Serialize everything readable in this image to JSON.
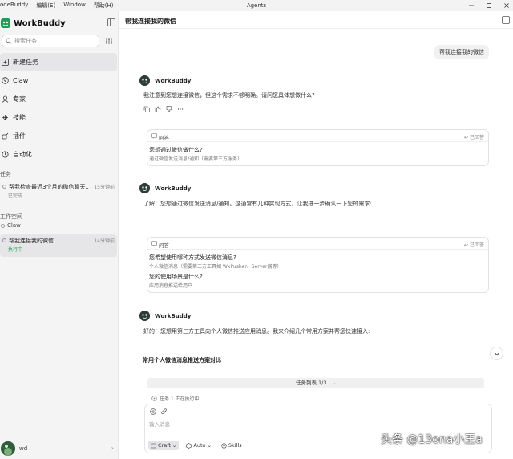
{
  "titlebar": {
    "menu": [
      "odeBuddy",
      "编辑(E)",
      "Window",
      "帮助(H)"
    ],
    "window_title": "Agents"
  },
  "sidebar": {
    "brand": "WorkBuddy",
    "search_placeholder": "搜索任务",
    "nav": [
      {
        "label": "新建任务",
        "icon": "new-task-icon"
      },
      {
        "label": "Claw",
        "icon": "claw-icon"
      },
      {
        "label": "专家",
        "icon": "expert-icon"
      },
      {
        "label": "技能",
        "icon": "skills-icon"
      },
      {
        "label": "插件",
        "icon": "plugin-icon"
      },
      {
        "label": "自动化",
        "icon": "automation-icon"
      }
    ],
    "tasks_label": "任务",
    "tasks": [
      {
        "title": "帮我检查最近3个月的微信聊天...",
        "time": "15分钟前",
        "status": "已完成"
      }
    ],
    "workspace_label": "工作空间",
    "workspace_item": "Claw",
    "workspace_tasks": [
      {
        "title": "帮我连接我的微信",
        "time": "14分钟前",
        "status": "执行中"
      }
    ],
    "user_name": "wd"
  },
  "main": {
    "title": "帮我连接我的微信",
    "user_message": "帮我连接我的微信",
    "messages": [
      {
        "name": "WorkBuddy",
        "text": "我注意到您想连接微信，但这个需求不够明确。请问您具体想做什么?"
      },
      {
        "name": "WorkBuddy",
        "text": "了解！您想通过微信发送消息/通知。这通常有几种实现方式，让我进一步确认一下您的需求:"
      },
      {
        "name": "WorkBuddy",
        "text": "好的！您想用第三方工具向个人微信推送应用消息。我来介绍几个常用方案并帮您快速接入:"
      }
    ],
    "qa_cards": [
      {
        "label": "问答",
        "done": "已回答",
        "items": [
          {
            "q": "您想通过微信做什么?",
            "a": "通过微信发送消息/通知（需要第三方服务）"
          }
        ]
      },
      {
        "label": "问答",
        "done": "已回答",
        "items": [
          {
            "q": "您希望使用哪种方式发送微信消息?",
            "a": "个人微信消息（需要第三方工具如 WxPusher、Server酱等）"
          },
          {
            "q": "您的使用场景是什么?",
            "a": "应用消息推送给用户"
          }
        ]
      }
    ],
    "section_title": "常用个人微信消息推送方案对比",
    "tasklist_label": "任务列表 1/3",
    "tasklist_status": "任务 1 正在执行中",
    "composer_placeholder": "输入消息",
    "tools": {
      "craft": "Craft",
      "auto": "Auto",
      "skills": "Skills"
    }
  },
  "watermark": "头条 @13ona小王a"
}
